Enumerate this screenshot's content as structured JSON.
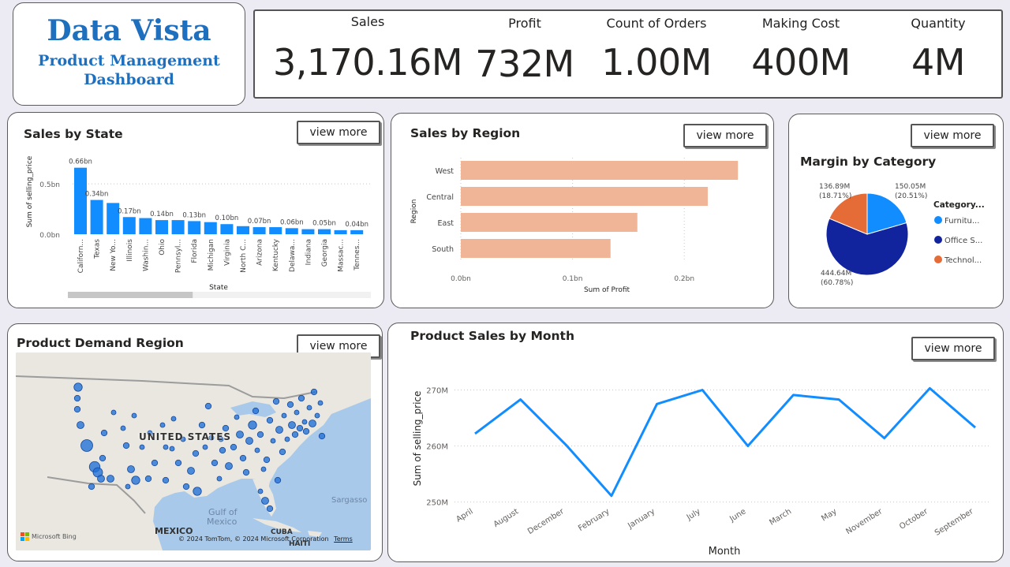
{
  "header": {
    "title": "Data Vista",
    "subtitle_line1": "Product Management",
    "subtitle_line2": "Dashboard"
  },
  "kpis": [
    {
      "label": "Sales",
      "value": "3,170.16M"
    },
    {
      "label": "Profit",
      "value": "732M"
    },
    {
      "label": "Count of Orders",
      "value": "1.00M"
    },
    {
      "label": "Making Cost",
      "value": "400M"
    },
    {
      "label": "Quantity",
      "value": "4M"
    }
  ],
  "view_more_label": "view more",
  "state_panel": {
    "title": "Sales by State",
    "scroll_position": 0.3
  },
  "region_panel": {
    "title": "Sales by Region"
  },
  "category_panel": {
    "title": "Margin by Category",
    "legend_title": "Category..."
  },
  "map_panel": {
    "title": "Product Demand Region",
    "labels": {
      "country": "UNITED STATES",
      "gulf_line1": "Gulf of",
      "gulf_line2": "Mexico",
      "mexico": "MEXICO",
      "sargasso": "Sargasso",
      "cuba": "CUBA",
      "haiti": "HAITI"
    },
    "bing": "Microsoft Bing",
    "copyright": "© 2024 TomTom, © 2024 Microsoft Corporation",
    "terms": "Terms"
  },
  "month_panel": {
    "title": "Product Sales by Month"
  },
  "colors": {
    "bar_blue": "#118dff",
    "region_bar": "#f0b497",
    "navy": "#12239e",
    "orange": "#e66c37",
    "line": "#118dff",
    "map_water": "#a8c9ea",
    "map_land": "#e9e7e0"
  },
  "chart_data": [
    {
      "type": "bar",
      "title": "Sales by State",
      "xlabel": "State",
      "ylabel": "Sum of selling_price",
      "categories": [
        "Californ...",
        "Texas",
        "New Yo...",
        "Illinois",
        "Washin...",
        "Ohio",
        "Pennsyl...",
        "Florida",
        "Michigan",
        "Virginia",
        "North C...",
        "Arizona",
        "Kentucky",
        "Delawa...",
        "Indiana",
        "Georgia",
        "Massac...",
        "Tennes..."
      ],
      "values": [
        0.66,
        0.34,
        0.31,
        0.17,
        0.16,
        0.14,
        0.14,
        0.13,
        0.12,
        0.1,
        0.08,
        0.07,
        0.07,
        0.06,
        0.05,
        0.05,
        0.04,
        0.04
      ],
      "data_labels": [
        "0.66bn",
        "0.34bn",
        "",
        "0.17bn",
        "",
        "0.14bn",
        "",
        "0.13bn",
        "",
        "0.10bn",
        "",
        "0.07bn",
        "",
        "0.06bn",
        "",
        "0.05bn",
        "",
        "0.04bn"
      ],
      "yticks": [
        "0.0bn",
        "0.5bn"
      ],
      "ylim": [
        0,
        0.72
      ],
      "grid": true
    },
    {
      "type": "bar",
      "orientation": "horizontal",
      "title": "Sales by Region",
      "xlabel": "Sum of Profit",
      "ylabel": "Region",
      "categories": [
        "West",
        "Central",
        "East",
        "South"
      ],
      "values": [
        0.248,
        0.221,
        0.158,
        0.134
      ],
      "xticks": [
        "0.0bn",
        "0.1bn",
        "0.2bn"
      ],
      "xlim": [
        0,
        0.25
      ],
      "grid": true
    },
    {
      "type": "pie",
      "title": "Margin by Category",
      "legend_title": "Category...",
      "slices": [
        {
          "name": "Furnitu...",
          "value": 150.05,
          "label": "150.05M",
          "pct": "(20.51%)",
          "color": "#118dff"
        },
        {
          "name": "Office S...",
          "value": 444.64,
          "label": "444.64M",
          "pct": "(60.78%)",
          "color": "#12239e"
        },
        {
          "name": "Technol...",
          "value": 136.89,
          "label": "136.89M",
          "pct": "(18.71%)",
          "color": "#e66c37"
        }
      ],
      "legend_position": "right"
    },
    {
      "type": "line",
      "title": "Product Sales by Month",
      "xlabel": "Month",
      "ylabel": "Sum of selling_price",
      "categories": [
        "April",
        "August",
        "December",
        "February",
        "January",
        "July",
        "June",
        "March",
        "May",
        "November",
        "October",
        "September"
      ],
      "values": [
        262.2,
        268.3,
        260.2,
        251.1,
        267.5,
        270.0,
        260.0,
        269.1,
        268.3,
        261.4,
        270.3,
        263.3
      ],
      "yticks": [
        "250M",
        "260M",
        "270M"
      ],
      "ylim": [
        249.8,
        271.2
      ],
      "grid": true
    }
  ]
}
